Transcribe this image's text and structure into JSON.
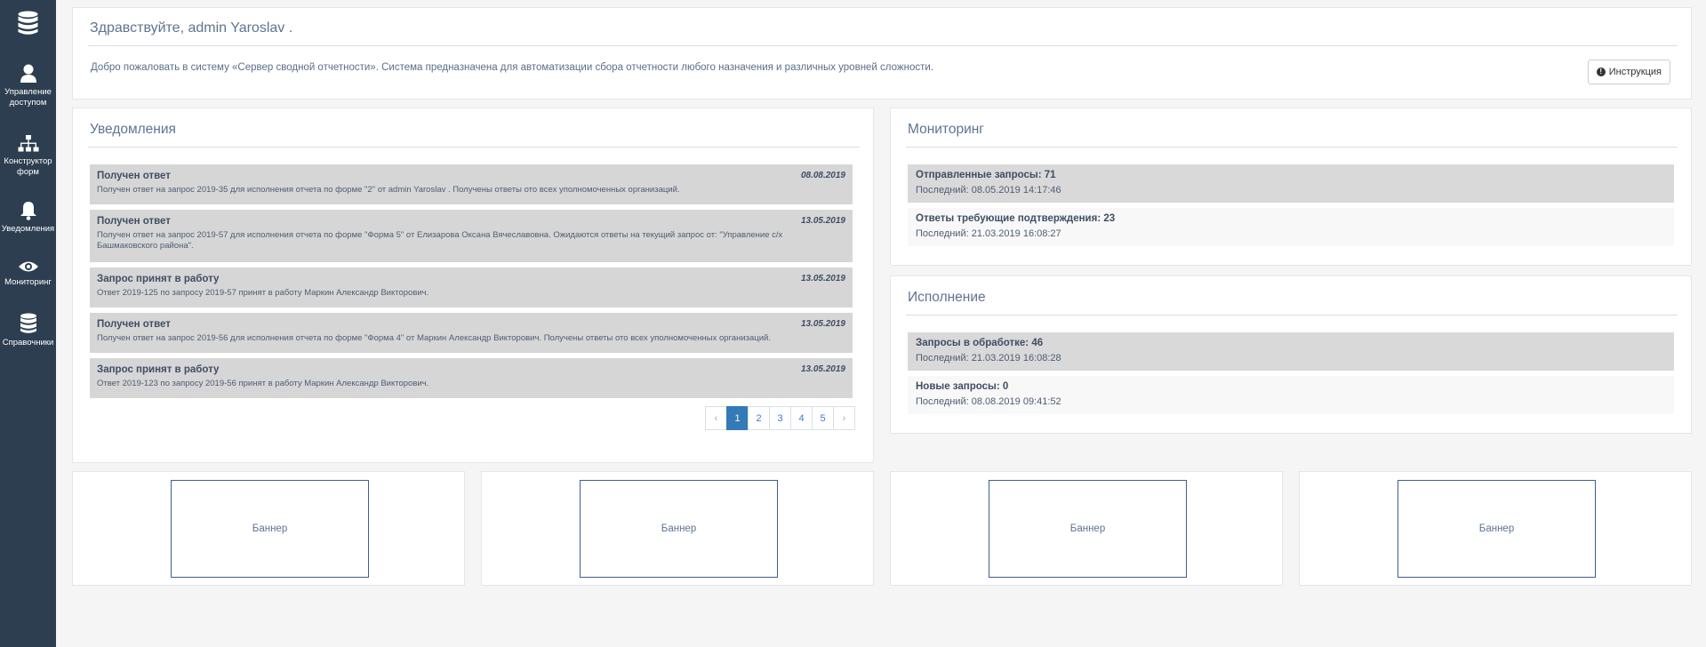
{
  "sidebar": {
    "items": [
      {
        "label_line1": "Управление",
        "label_line2": "доступом"
      },
      {
        "label_line1": "Конструктор",
        "label_line2": "форм"
      },
      {
        "label_line1": "Уведомления",
        "label_line2": ""
      },
      {
        "label_line1": "Мониторинг",
        "label_line2": ""
      },
      {
        "label_line1": "Справочники",
        "label_line2": ""
      }
    ]
  },
  "welcome": {
    "title": "Здравствуйте, admin Yaroslav .",
    "text": "Добро пожаловать в систему «Сервер сводной отчетности». Система предназначена для автоматизации сбора отчетности любого назначения и различных уровней сложности.",
    "button_label": "Инструкция"
  },
  "notifications": {
    "title": "Уведомления",
    "items": [
      {
        "title": "Получен ответ",
        "date": "08.08.2019",
        "body": "Получен ответ на запрос 2019-35 для исполнения отчета по форме \"2\" от admin Yaroslav . Получены ответы ото всех уполномоченных организаций."
      },
      {
        "title": "Получен ответ",
        "date": "13.05.2019",
        "body": "Получен ответ на запрос 2019-57 для исполнения отчета по форме \"Форма 5\" от Елизарова Оксана Вячеславовна. Ожидаются ответы на текущий запрос от: \"Управление с/х Башмаковского района\"."
      },
      {
        "title": "Запрос принят в работу",
        "date": "13.05.2019",
        "body": "Ответ 2019-125 по запросу 2019-57 принят в работу Маркин Александр Викторович."
      },
      {
        "title": "Получен ответ",
        "date": "13.05.2019",
        "body": "Получен ответ на запрос 2019-56 для исполнения отчета по форме \"Форма 4\" от Маркин Александр Викторович. Получены ответы ото всех уполномоченных организаций."
      },
      {
        "title": "Запрос принят в работу",
        "date": "13.05.2019",
        "body": "Ответ 2019-123 по запросу 2019-56 принят в работу Маркин Александр Викторович."
      }
    ],
    "pagination": {
      "prev": "‹",
      "pages": [
        "1",
        "2",
        "3",
        "4",
        "5"
      ],
      "next": "›",
      "current": "1"
    }
  },
  "monitoring": {
    "title": "Мониторинг",
    "rows": [
      {
        "label": "Отправленные запросы: 71",
        "sub": "Последний: 08.05.2019 14:17:46"
      },
      {
        "label": "Ответы требующие подтверждения: 23",
        "sub": "Последний: 21.03.2019 16:08:27"
      }
    ]
  },
  "execution": {
    "title": "Исполнение",
    "rows": [
      {
        "label": "Запросы в обработке: 46",
        "sub": "Последний: 21.03.2019 16:08:28"
      },
      {
        "label": "Новые запросы: 0",
        "sub": "Последний: 08.08.2019 09:41:52"
      }
    ]
  },
  "banners": [
    "Баннер",
    "Баннер",
    "Баннер",
    "Баннер"
  ],
  "colors": {
    "sidebar": "#2d3e50",
    "accent": "#337ab7",
    "row_grey": "#d9d9d9"
  }
}
